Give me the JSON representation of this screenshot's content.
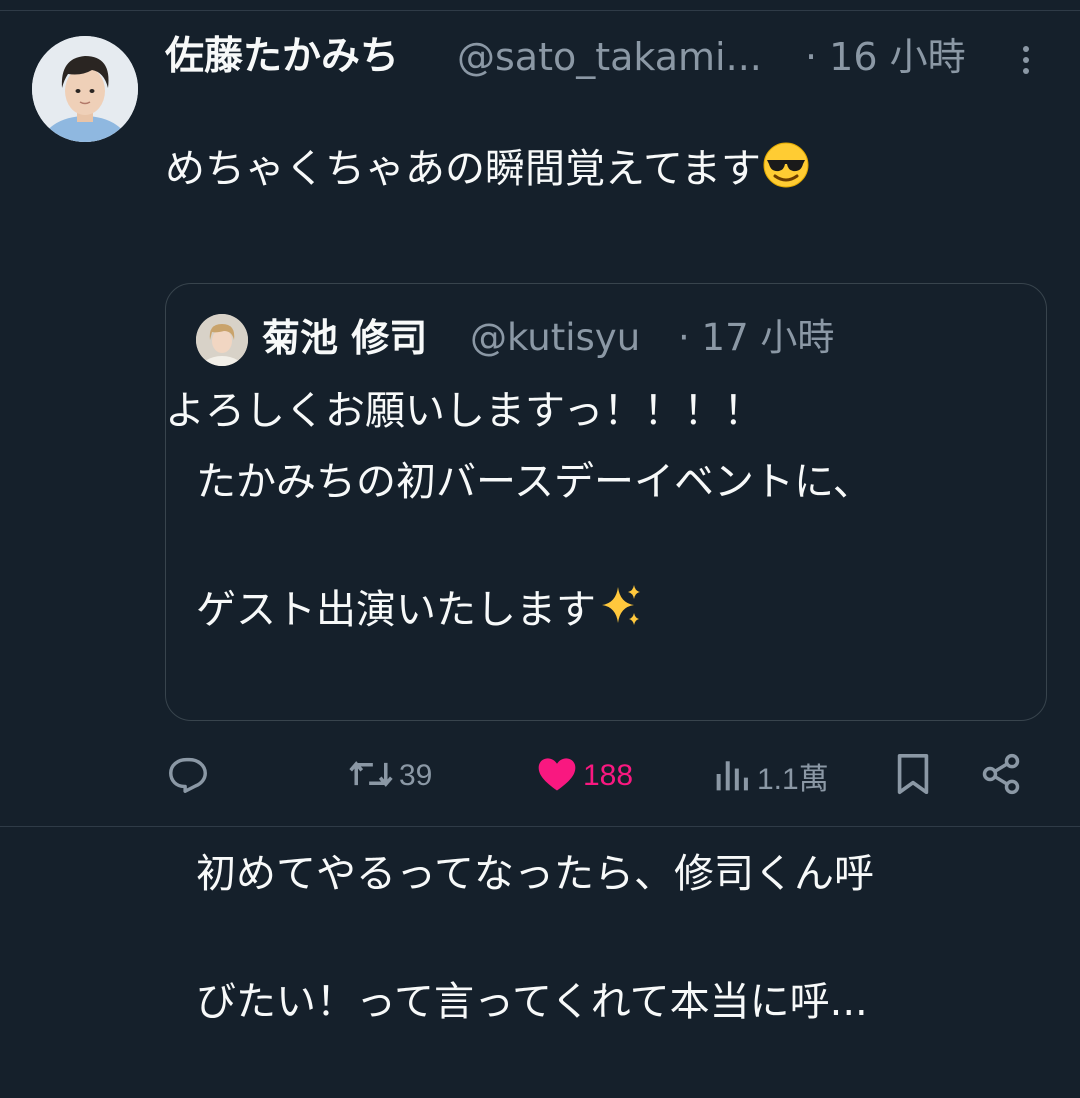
{
  "tweet": {
    "display_name": "佐藤たかみち",
    "handle": "@sato_takami...",
    "time": "· 16 小時",
    "text_line1": "めちゃくちゃあの瞬間覚えてます",
    "text_line1_emoji": "smiling-face-with-sunglasses",
    "text_line2": "よろしくお願いしますっ！！！！"
  },
  "quote": {
    "display_name": "菊池 修司",
    "handle": "@kutisyu",
    "time": "· 17 小時",
    "text_line1": "たかみちの初バースデーイベントに、",
    "text_line2": "ゲスト出演いたします",
    "text_line2_emoji": "sparkles",
    "text_line3": "初めてやるってなったら、修司くん呼",
    "text_line4": "びたい！って言ってくれて本当に呼..."
  },
  "actions": {
    "reply_icon": "reply-icon",
    "retweet_icon": "retweet-icon",
    "retweet_count": "39",
    "like_icon": "heart-icon",
    "like_count": "188",
    "views_icon": "views-icon",
    "views_count": "1.1萬",
    "bookmark_icon": "bookmark-icon",
    "share_icon": "share-icon"
  },
  "colors": {
    "background": "#15202b",
    "text_primary": "#f7f9f9",
    "text_secondary": "#8b98a5",
    "like_pink": "#f91880",
    "border": "#38444d"
  }
}
